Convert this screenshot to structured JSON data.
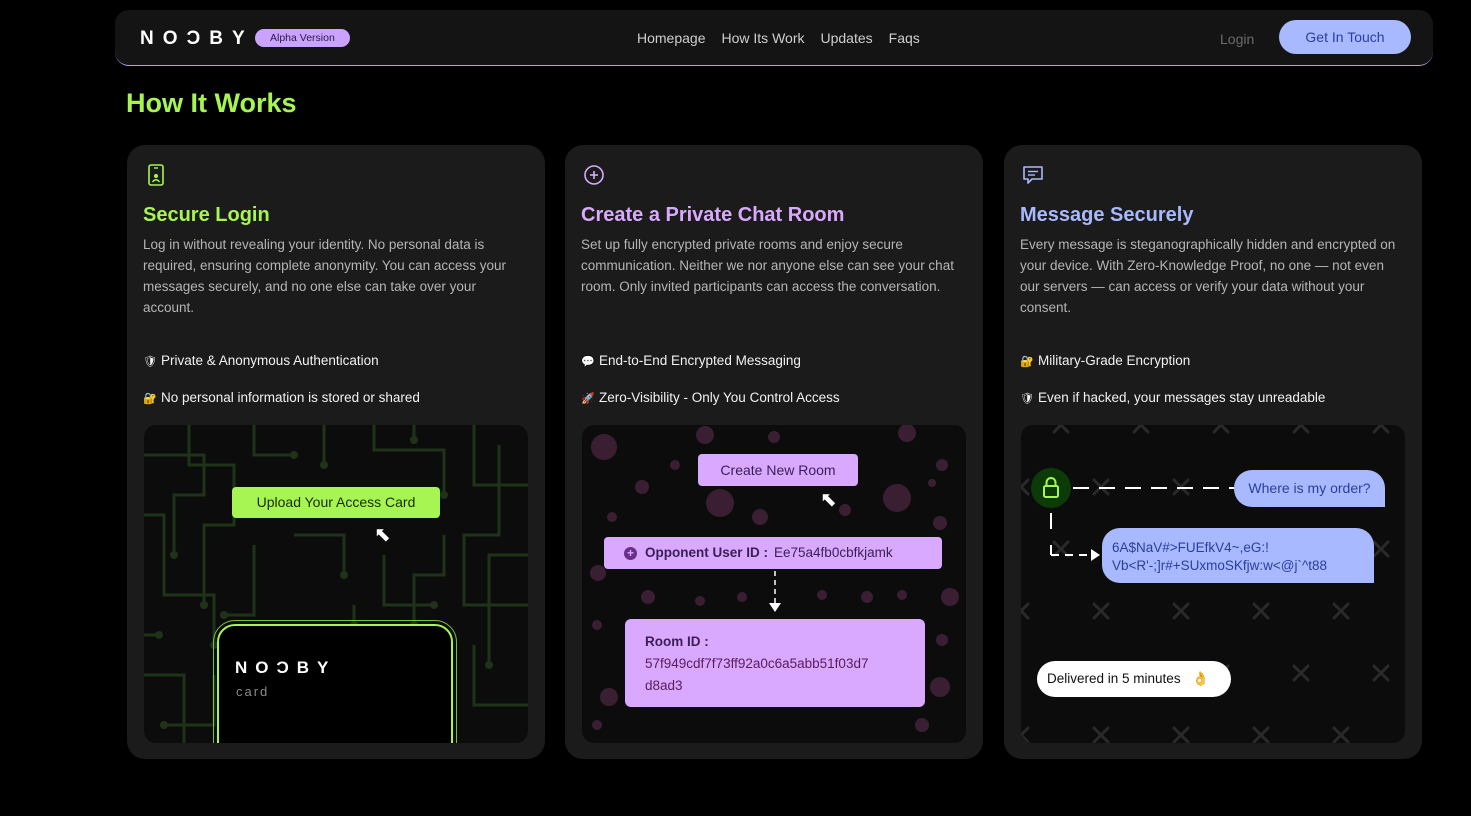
{
  "nav": {
    "logo": "NOƆBY",
    "badge": "Alpha Version",
    "links": [
      "Homepage",
      "How Its Work",
      "Updates",
      "Faqs"
    ],
    "login": "Login",
    "cta": "Get In Touch"
  },
  "page_title": "How It Works",
  "colors": {
    "green": "#a6f552",
    "purple": "#d9a8ff",
    "blue": "#a9b9ff",
    "card_bg": "#1b1b1b"
  },
  "cards": [
    {
      "icon": "phone-id-icon",
      "title": "Secure Login",
      "description": "Log in without revealing your identity. No personal data is required, ensuring complete anonymity. You can access your messages securely, and no one else can take over your account.",
      "features": [
        {
          "icon": "🛡",
          "text": "Private & Anonymous Authentication"
        },
        {
          "icon": "🔐",
          "text": "No personal information is stored or shared"
        }
      ],
      "illustration": {
        "button": "Upload Your Access Card",
        "card_logo": "NOƆBY",
        "card_sub": "card"
      }
    },
    {
      "icon": "plus-circle-icon",
      "title": "Create a Private Chat Room",
      "description": "Set up fully encrypted private rooms and enjoy secure communication. Neither we nor anyone else can see your chat room. Only invited participants can access the conversation.",
      "features": [
        {
          "icon": "💬",
          "text": "End-to-End Encrypted Messaging"
        },
        {
          "icon": "🚀",
          "text": "Zero-Visibility - Only You Control Access"
        }
      ],
      "illustration": {
        "button": "Create New Room",
        "opponent_label": "Opponent User ID :",
        "opponent_value": "Ee75a4fb0cbfkjamk",
        "room_label": "Room ID :",
        "room_value_1": "57f949cdf7f73ff92a0c6a5abb51f03d7",
        "room_value_2": "d8ad3"
      }
    },
    {
      "icon": "chat-bubble-icon",
      "title": "Message Securely",
      "description": "Every message is steganographically hidden and encrypted on your device. With Zero-Knowledge Proof, no one — not even our servers — can access or verify your data without your consent.",
      "features": [
        {
          "icon": "🔐",
          "text": "Military-Grade Encryption"
        },
        {
          "icon": "🛡",
          "text": "Even if hacked, your messages stay unreadable"
        }
      ],
      "illustration": {
        "question": "Where is my order?",
        "encrypted_1": "6A$NaV#>FUEfkV4~,eG:!",
        "encrypted_2": "Vb<R'-;]r#+SUxmoSKfjw:w<@j`^t88",
        "delivered": "Delivered in 5 minutes",
        "delivered_emoji": "👌"
      }
    }
  ]
}
